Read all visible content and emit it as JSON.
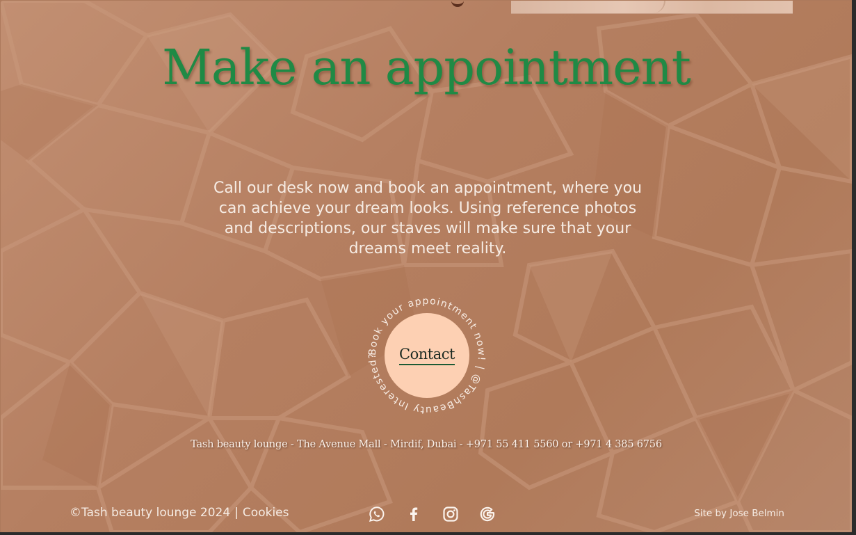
{
  "hero": {
    "title": "Make an appointment",
    "description": "Call our desk now and book an appointment, where you can achieve your dream looks. Using reference photos and descriptions, our staves will make sure that your dreams meet reality."
  },
  "contact_badge": {
    "button_label": "Contact",
    "ring_text": "Book your appointment now! | @TashBeauty Interested? "
  },
  "address": "Tash beauty lounge - The Avenue Mall - Mirdif, Dubai - +971 55 411 5560 or +971 4 385 6756",
  "footer": {
    "copyright": "©Tash beauty lounge 2024",
    "separator": "|",
    "cookies": "Cookies",
    "credit": "Site by Jose Belmin",
    "socials": [
      {
        "name": "whatsapp",
        "icon": "whatsapp-icon"
      },
      {
        "name": "facebook",
        "icon": "facebook-icon"
      },
      {
        "name": "instagram",
        "icon": "instagram-icon"
      },
      {
        "name": "google",
        "icon": "google-icon"
      }
    ]
  },
  "colors": {
    "accent_green": "#1f8a45",
    "background_terracotta": "#b57f61",
    "button_peach": "#fdd0b3",
    "text_light": "#f6ece4"
  }
}
